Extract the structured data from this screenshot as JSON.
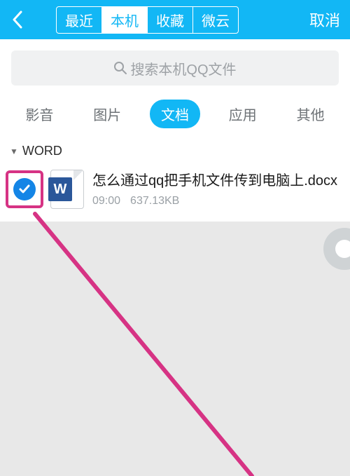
{
  "header": {
    "tabs": [
      "最近",
      "本机",
      "收藏",
      "微云"
    ],
    "active_tab_index": 1,
    "cancel_label": "取消"
  },
  "search": {
    "placeholder": "搜索本机QQ文件"
  },
  "categories": {
    "items": [
      "影音",
      "图片",
      "文档",
      "应用",
      "其他"
    ],
    "active_index": 2
  },
  "section": {
    "title": "WORD"
  },
  "file": {
    "name": "怎么通过qq把手机文件传到电脑上.docx",
    "time": "09:00",
    "size": "637.13KB",
    "selected": true
  },
  "colors": {
    "primary": "#12b7f5",
    "annotation": "#d63384"
  }
}
